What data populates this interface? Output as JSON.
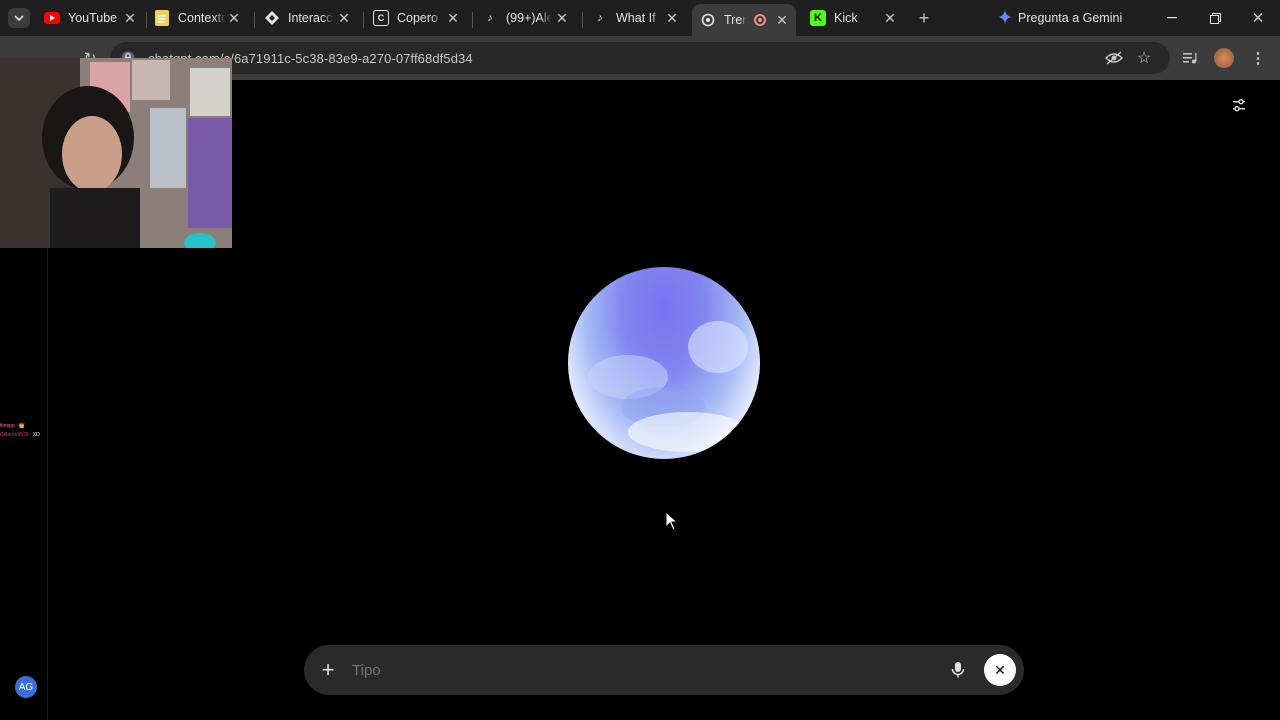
{
  "tabs": [
    {
      "title": "YouTube",
      "icon": "youtube-icon",
      "color": "#ff0000"
    },
    {
      "title": "Contexto",
      "icon": "docs-icon",
      "color": "#f2cf5b"
    },
    {
      "title": "Interacci",
      "icon": "diamond-icon",
      "color": "#e3e3e3"
    },
    {
      "title": "Copero",
      "icon": "copero-icon",
      "color": "#e3e3e3"
    },
    {
      "title": "(99+)Ale",
      "icon": "tiktok-icon",
      "color": "#e3e3e3"
    },
    {
      "title": "What If",
      "icon": "tiktok-icon",
      "color": "#e3e3e3"
    },
    {
      "title": "Tren",
      "icon": "chatgpt-icon",
      "color": "#e3e3e3",
      "active": true,
      "recording": true
    },
    {
      "title": "Kick",
      "icon": "kick-icon",
      "color": "#53fc18"
    }
  ],
  "gemini": {
    "label": "Pregunta a Gemini"
  },
  "address": {
    "url": "chatgpt.com/c/6a71911c-5c38-83e9-a270-07ff68df5d34"
  },
  "composer": {
    "placeholder": "Tipo"
  },
  "sidebar": {
    "avatar": "AG"
  },
  "chat": {
    "lines": [
      {
        "user": "tlinepp :",
        "msg": "👑"
      },
      {
        "user": "Gilberto9576 :",
        "msg": "XD"
      }
    ]
  },
  "colors": {
    "orb_top": "#7c72f2",
    "orb_bottom": "#ffffff",
    "background": "#000000",
    "tabbar": "#1f1f1f"
  }
}
